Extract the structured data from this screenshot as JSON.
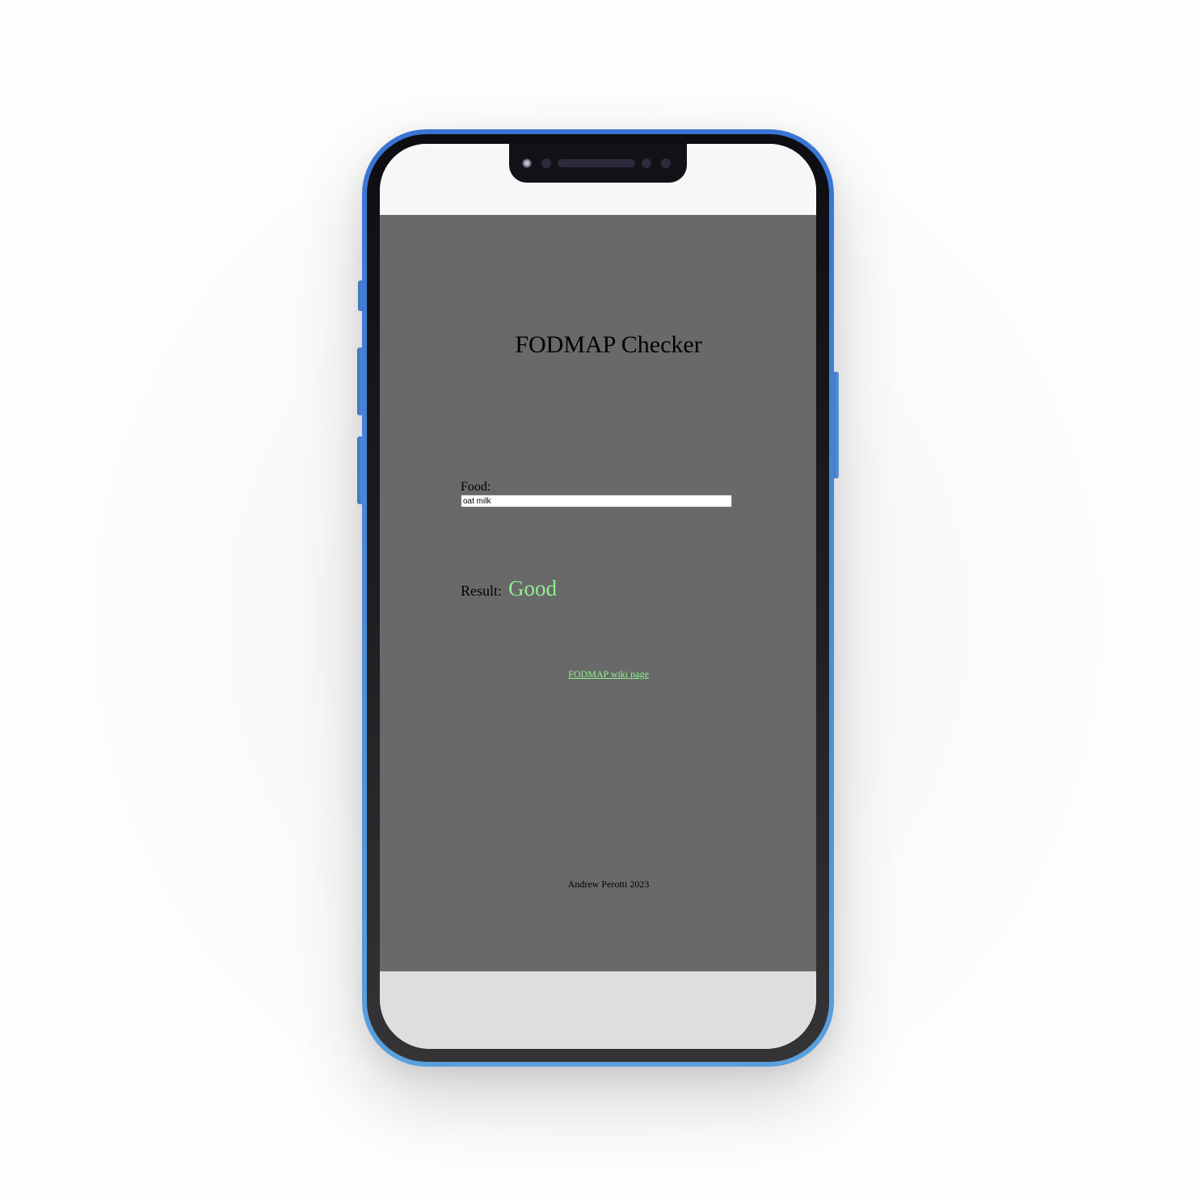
{
  "app": {
    "title": "FODMAP Checker",
    "food_label": "Food:",
    "food_input_value": "oat milk",
    "result_label": "Result:",
    "result_value": "Good",
    "link_text": "FODMAP wiki page",
    "footer_text": "Andrew Perotti 2023"
  },
  "colors": {
    "app_background": "#696969",
    "result_good": "#90ee90",
    "link": "#90ee90",
    "phone_frame": "#4a8ad9"
  }
}
